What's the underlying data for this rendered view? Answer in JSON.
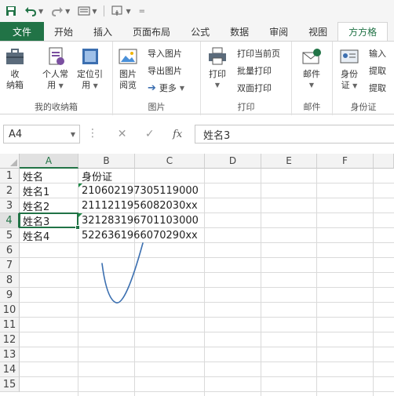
{
  "colors": {
    "accent": "#217346",
    "error_indicator": "#1e8a47",
    "annotation_stroke": "#3b6fb0"
  },
  "quick_access": {
    "save_icon": "save-icon",
    "undo_icon": "undo-icon",
    "redo_icon": "redo-icon",
    "form_icon": "form-icon",
    "touch_icon": "touch-mode-icon",
    "customize_icon": "customize-qat-icon"
  },
  "tabs": [
    "文件",
    "开始",
    "插入",
    "页面布局",
    "公式",
    "数据",
    "审阅",
    "视图",
    "方方格"
  ],
  "ribbon": {
    "group_collect": {
      "label": "我的收纳箱",
      "collect_btn": [
        "收",
        "纳箱"
      ],
      "personal_btn": [
        "个人常",
        "用"
      ],
      "locate_btn": [
        "定位引",
        "用"
      ]
    },
    "group_image": {
      "label": "图片",
      "browse_btn": [
        "图片",
        "阅览"
      ],
      "import_img": "导入图片",
      "export_img": "导出图片",
      "more": "更多"
    },
    "group_print": {
      "label": "打印",
      "print_btn": "打印",
      "print_current": "打印当前页",
      "batch_print": "批量打印",
      "duplex_print": "双面打印"
    },
    "group_mail": {
      "label": "邮件",
      "mail_btn": "邮件"
    },
    "group_id": {
      "label": "身份证",
      "id_btn": [
        "身份",
        "证"
      ],
      "input": "输入",
      "extract1": "提取",
      "extract2": "提取"
    }
  },
  "formula_bar": {
    "name_box": "A4",
    "cancel": "✕",
    "enter": "✓",
    "fx": "fx",
    "value": "姓名3"
  },
  "sheet": {
    "columns": [
      "A",
      "B",
      "C",
      "D",
      "E",
      "F"
    ],
    "rows": [
      "1",
      "2",
      "3",
      "4",
      "5",
      "6",
      "7",
      "8",
      "9",
      "10",
      "11",
      "12",
      "13",
      "14",
      "15"
    ],
    "data": [
      [
        "姓名",
        "身份证"
      ],
      [
        "姓名1",
        "210602197305119000"
      ],
      [
        "姓名2",
        "2111211956082030xx"
      ],
      [
        "姓名3",
        "321283196701103000"
      ],
      [
        "姓名4",
        "5226361966070290xx"
      ]
    ]
  }
}
